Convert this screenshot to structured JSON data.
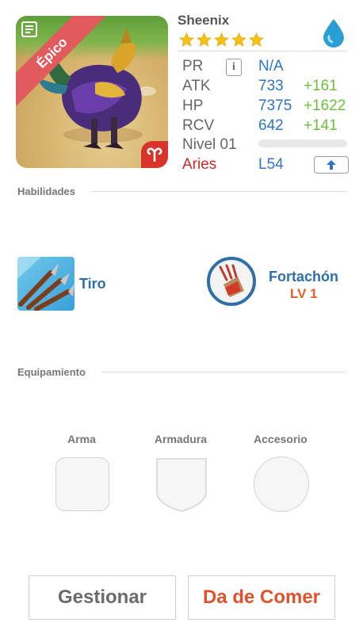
{
  "monster": {
    "name": "Sheenix",
    "rarity": "Épico",
    "star_count": 5,
    "element_icon": "water-drop-icon",
    "zodiac_icon": "aries-icon"
  },
  "stats": {
    "pr_label": "PR",
    "pr_value": "N/A",
    "atk_label": "ATK",
    "atk_value": "733",
    "atk_bonus": "+161",
    "hp_label": "HP",
    "hp_value": "7375",
    "hp_bonus": "+1622",
    "rcv_label": "RCV",
    "rcv_value": "642",
    "rcv_bonus": "+141",
    "level_label": "Nivel 01",
    "level_progress": 0,
    "zodiac_label": "Aries",
    "zodiac_level": "L54"
  },
  "skills": {
    "title": "Habilidades",
    "active": {
      "name": "Tiro",
      "icon": "arrows-icon"
    },
    "passive": {
      "name": "Fortachón",
      "level": "LV 1",
      "icon": "claw-shield-icon"
    }
  },
  "equipment": {
    "title": "Equipamiento",
    "slots": [
      {
        "label": "Arma"
      },
      {
        "label": "Armadura"
      },
      {
        "label": "Accesorio"
      }
    ]
  },
  "actions": {
    "manage": "Gestionar",
    "feed": "Da de Comer"
  },
  "colors": {
    "stat_value": "#2e77c2",
    "stat_bonus": "#6dbf3e",
    "aries": "#cf2a2a",
    "feed_button": "#e0522a",
    "rarity_ribbon": "#e05a5e"
  }
}
